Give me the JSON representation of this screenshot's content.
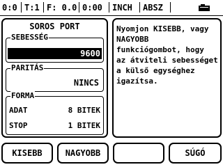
{
  "status_bar": {
    "datum": "0:0",
    "tool": "T:1",
    "feed": "F: 0.0",
    "timer": "0:00",
    "units": "INCH",
    "mode": "ABSZ",
    "icon": "camera-icon"
  },
  "serial_port": {
    "title": "SOROS PORT",
    "speed": {
      "label": "SEBESSÉG",
      "value": "9600"
    },
    "parity": {
      "label": "PARITÁS",
      "value": "NINCS"
    },
    "format": {
      "label": "FORMA",
      "data_label": "ADAT",
      "data_value": "8 BITEK",
      "stop_label": "STOP",
      "stop_value": "1 BITEK"
    }
  },
  "help": {
    "text": "Nyomjon KISEBB, vagy\nNAGYOBB\nfunkciógombot, hogy\naz átviteli sebességet\na külső egységhez\nigazítsa."
  },
  "softkeys": {
    "smaller": "KISEBB",
    "larger": "NAGYOBB",
    "empty": "",
    "help": "SÚGÓ"
  }
}
